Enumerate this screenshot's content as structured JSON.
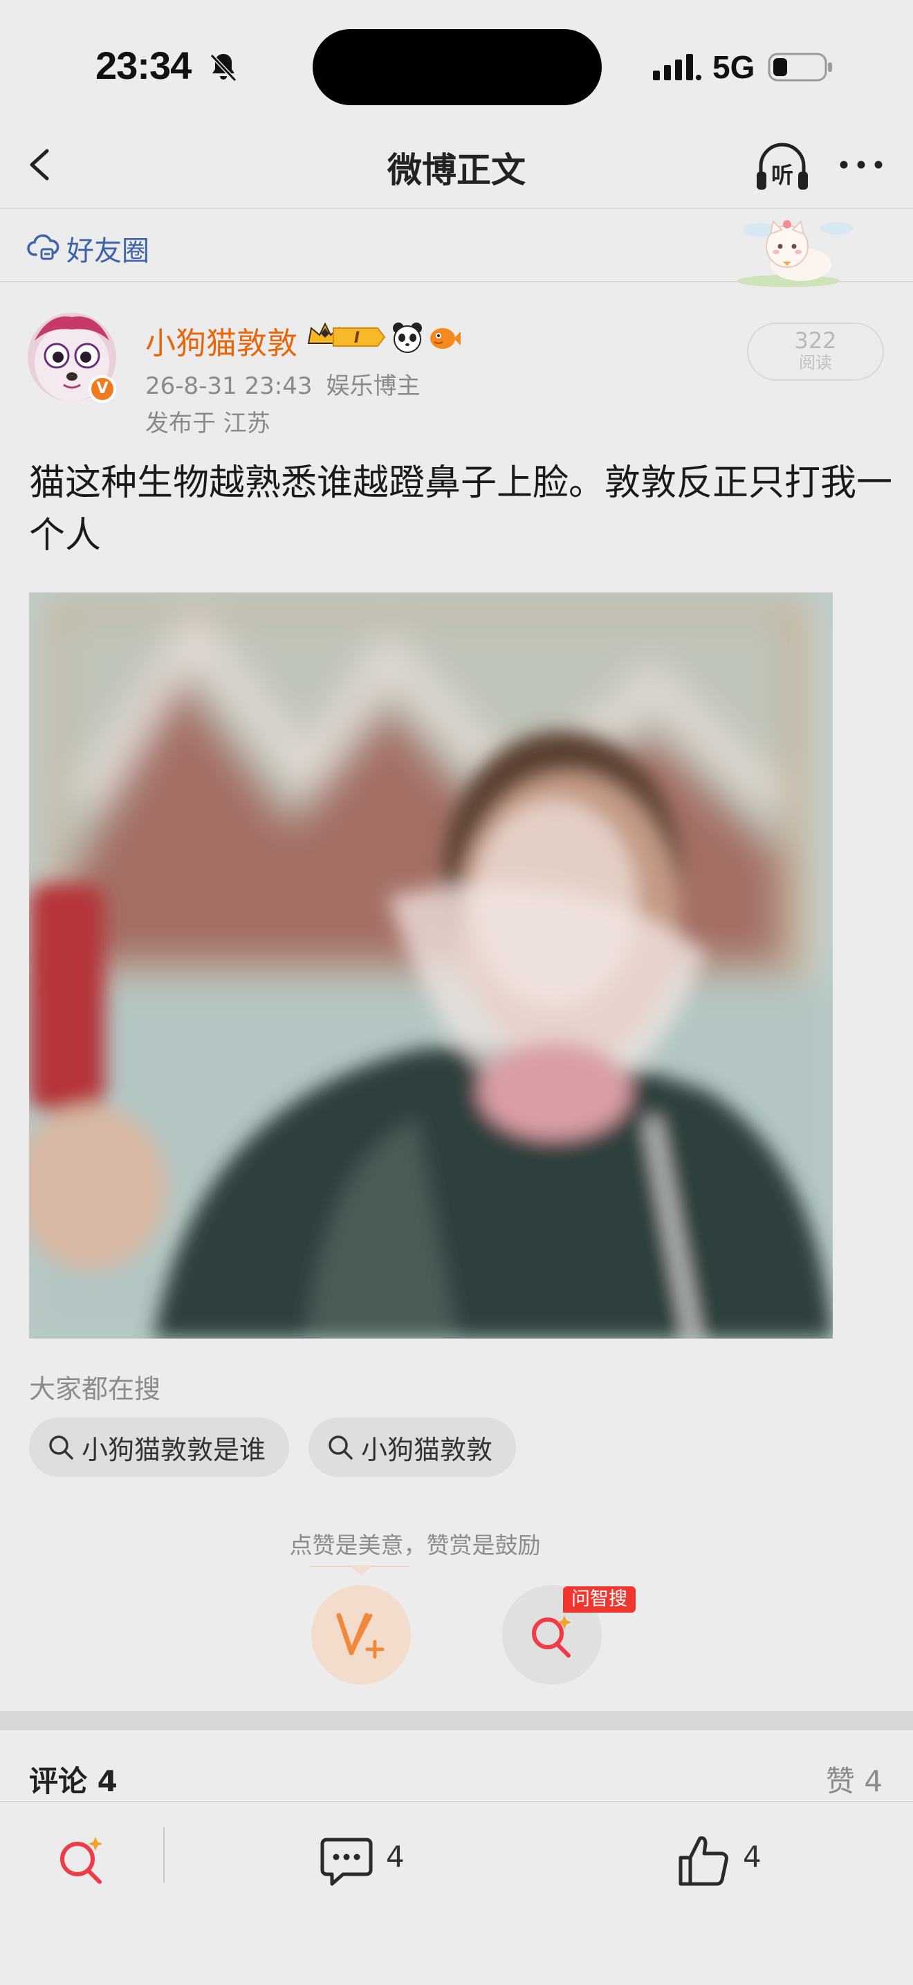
{
  "status_bar": {
    "time": "23:34",
    "network": "5G"
  },
  "nav": {
    "title": "微博正文",
    "listen_label": "听"
  },
  "friend_bar": {
    "label": "好友圈"
  },
  "post": {
    "username": "小狗猫敦敦",
    "verified_badge": "V",
    "crown_badge_text": "I",
    "datetime": "26-8-31 23:43",
    "category": "娱乐博主",
    "location": "发布于 江苏",
    "read_count": "322",
    "read_label": "阅读",
    "text": "猫这种生物越熟悉谁越蹬鼻子上脸。敦敦反正只打我一个人"
  },
  "search_suggestions": {
    "title": "大家都在搜",
    "items": [
      "小狗猫敦敦是谁",
      "小狗猫敦敦"
    ]
  },
  "reward": {
    "hint": "点赞是美意，赞赏是鼓励",
    "wen_tag": "问智搜"
  },
  "comments_header": {
    "title": "评论 4",
    "likes": "赞 4"
  },
  "toolbar": {
    "comment_count": "4",
    "like_count": "4"
  },
  "colors": {
    "accent_orange": "#e8650a",
    "link_blue": "#3f63a8",
    "wen_red": "#f0362f"
  }
}
